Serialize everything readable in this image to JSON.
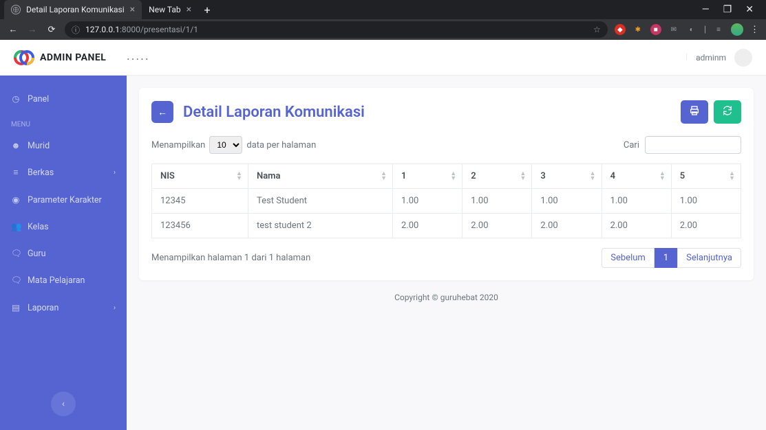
{
  "browser": {
    "tabs": [
      {
        "title": "Detail Laporan Komunikasi",
        "active": true
      },
      {
        "title": "New Tab",
        "active": false
      }
    ],
    "url_host": "127.0.0.1",
    "url_port": ":8000",
    "url_path": "/presentasi/1/1"
  },
  "topbar": {
    "brand": "ADMIN PANEL",
    "dots": ".....",
    "username": "adminm"
  },
  "sidebar": {
    "top_item": "Panel",
    "menu_header": "MENU",
    "items": [
      {
        "label": "Murid",
        "icon": "person",
        "caret": false
      },
      {
        "label": "Berkas",
        "icon": "bars",
        "caret": true
      },
      {
        "label": "Parameter Karakter",
        "icon": "dot",
        "caret": false
      },
      {
        "label": "Kelas",
        "icon": "group",
        "caret": false
      },
      {
        "label": "Guru",
        "icon": "chat",
        "caret": false
      },
      {
        "label": "Mata Pelajaran",
        "icon": "chat",
        "caret": false
      },
      {
        "label": "Laporan",
        "icon": "file",
        "caret": true
      }
    ]
  },
  "page": {
    "title": "Detail Laporan Komunikasi",
    "perpage_prefix": "Menampilkan",
    "perpage_value": "10",
    "perpage_suffix": "data per halaman",
    "search_label": "Cari",
    "columns": [
      "NIS",
      "Nama",
      "1",
      "2",
      "3",
      "4",
      "5"
    ],
    "rows": [
      {
        "nis": "12345",
        "nama": "Test Student",
        "v": [
          "1.00",
          "1.00",
          "1.00",
          "1.00",
          "1.00"
        ]
      },
      {
        "nis": "123456",
        "nama": "test student 2",
        "v": [
          "2.00",
          "2.00",
          "2.00",
          "2.00",
          "2.00"
        ]
      }
    ],
    "page_info": "Menampilkan halaman 1 dari 1 halaman",
    "prev_label": "Sebelum",
    "page_number": "1",
    "next_label": "Selanjutnya"
  },
  "footer": {
    "text": "Copyright © guruhebat 2020"
  }
}
